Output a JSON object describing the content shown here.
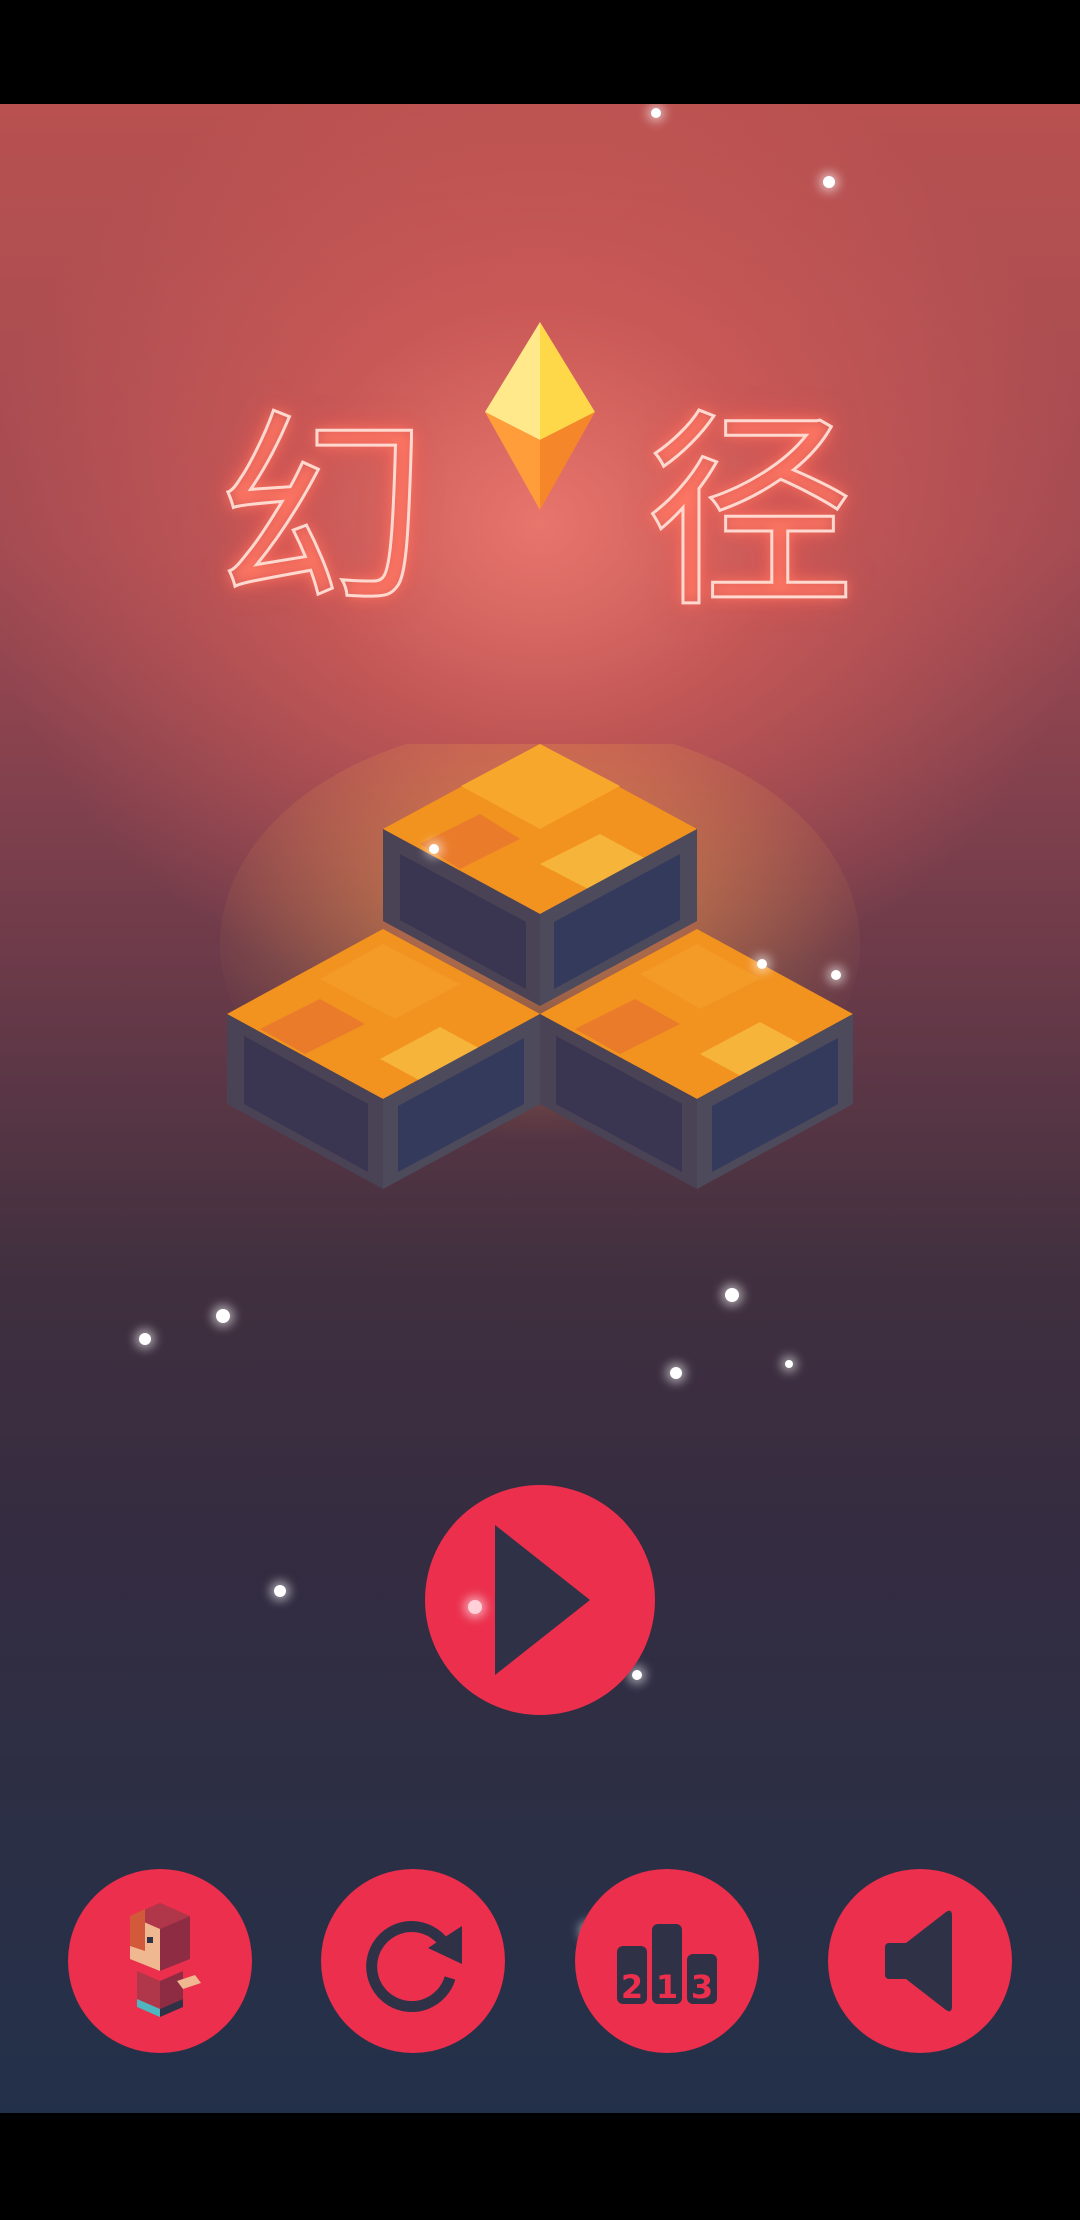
{
  "title": {
    "char1": "幻",
    "char2": "径"
  },
  "colors": {
    "accent": "#eb2f4c",
    "icon_dark": "#2f3147",
    "tile_orange": "#f0901e",
    "gem_yellow": "#ffd84a"
  },
  "buttons": {
    "play": {
      "icon": "play-icon"
    },
    "character": {
      "icon": "character-icon"
    },
    "restart": {
      "icon": "restart-icon"
    },
    "ranking": {
      "icon": "leaderboard-icon",
      "digits": [
        "2",
        "1",
        "3"
      ]
    },
    "sound": {
      "icon": "speaker-icon"
    }
  }
}
